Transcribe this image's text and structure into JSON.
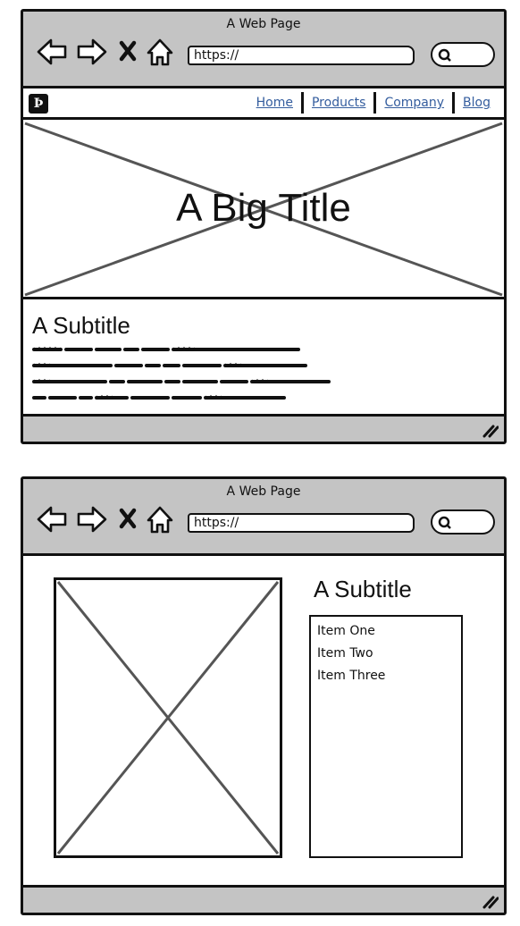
{
  "browser_top": {
    "window_title": "A Web Page",
    "url": "https://",
    "nav_links": [
      "Home",
      "Products",
      "Company",
      "Blog"
    ],
    "hero_title": "A Big Title",
    "subtitle": "A Subtitle"
  },
  "browser_bottom": {
    "window_title": "A Web Page",
    "url": "https://",
    "subtitle": "A Subtitle",
    "list_items": [
      "Item One",
      "Item Two",
      "Item Three"
    ]
  },
  "colors": {
    "chrome": "#c4c4c4",
    "link": "#345d9e",
    "outline": "#111111"
  },
  "icons": [
    "back-arrow-icon",
    "forward-arrow-icon",
    "stop-x-icon",
    "home-icon",
    "search-icon",
    "resize-grip-icon",
    "logo-icon"
  ]
}
